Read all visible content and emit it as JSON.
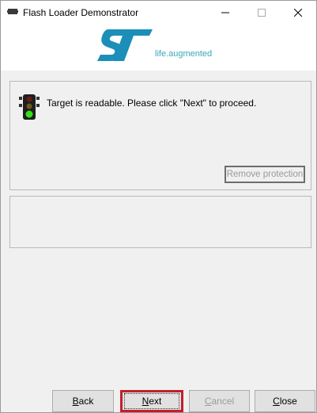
{
  "window": {
    "title": "Flash Loader Demonstrator",
    "controls": {
      "minimize": "—",
      "maximize": "☐",
      "close": "✕"
    }
  },
  "logo": {
    "brand": "ST",
    "tagline": "life.augmented",
    "brand_color": "#1b8fb8"
  },
  "status": {
    "message": "Target is readable. Please click \"Next\" to proceed.",
    "indicator": "traffic-light-green"
  },
  "buttons": {
    "remove_protection": "Remove protection",
    "back": {
      "mnemonic": "B",
      "rest": "ack"
    },
    "next": {
      "mnemonic": "N",
      "rest": "ext"
    },
    "cancel": {
      "mnemonic": "C",
      "rest": "ancel"
    },
    "close": {
      "mnemonic": "C",
      "rest": "lose"
    }
  },
  "colors": {
    "highlight": "#c0202a",
    "disabled_text": "#9a9a9a"
  }
}
